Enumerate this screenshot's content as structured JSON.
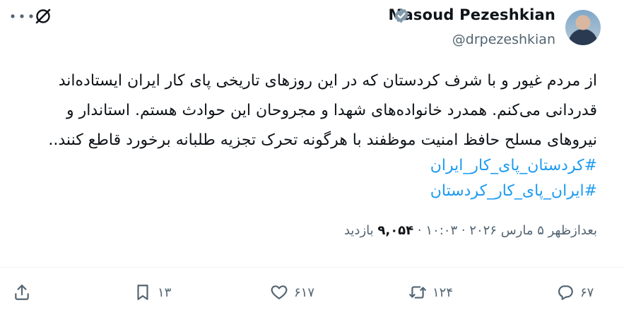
{
  "author": {
    "name": "Masoud Pezeshkian",
    "handle": "@drpezeshkian"
  },
  "tweet": {
    "text": "از مردم غیور و با شرف کردستان که در این روزهای تاریخی پای کار ایران ایستاده‌اند\nقدردانی می‌کنم. همدرد خانواده‌های شهدا و مجروحان این حوادث هستم. استاندار و\nنیروهای مسلح حافظ امنیت موظفند با هرگونه تحرک تجزیه طلبانه برخورد قاطع کنند..",
    "hashtags": [
      "#کردستان_پای_کار_ایران",
      "#ایران_پای_کار_کردستان"
    ],
    "timestamp": "بعدازظهر ۵ مارس ۲۰۲۶ · ۱۰:۰۳",
    "separator": "·",
    "views_count": "۹,۰۵۴",
    "views_label": "بازدید"
  },
  "actions": {
    "replies": "۶۷",
    "retweets": "۱۲۴",
    "likes": "۶۱۷",
    "bookmarks": "۱۳"
  },
  "colors": {
    "link": "#1d9bf0",
    "secondary": "#536471",
    "verified": "#829aab"
  }
}
